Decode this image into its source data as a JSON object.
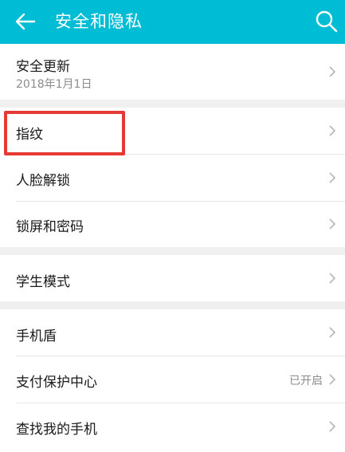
{
  "colors": {
    "accent": "#00bcd4",
    "highlight": "#e53935"
  },
  "header": {
    "back_icon": "arrow-left-icon",
    "title": "安全和隐私",
    "search_icon": "search-icon"
  },
  "groups": [
    {
      "items": [
        {
          "label": "安全更新",
          "sub": "2018年1月1日",
          "chevron_icon": "chevron-right-icon"
        }
      ]
    },
    {
      "items": [
        {
          "label": "指纹",
          "chevron_icon": "chevron-right-icon"
        },
        {
          "label": "人脸解锁",
          "chevron_icon": "chevron-right-icon"
        },
        {
          "label": "锁屏和密码",
          "chevron_icon": "chevron-right-icon"
        }
      ]
    },
    {
      "items": [
        {
          "label": "学生模式",
          "chevron_icon": "chevron-right-icon"
        }
      ]
    },
    {
      "items": [
        {
          "label": "手机盾",
          "chevron_icon": "chevron-right-icon"
        },
        {
          "label": "支付保护中心",
          "value": "已开启",
          "chevron_icon": "chevron-right-icon"
        },
        {
          "label": "查找我的手机",
          "chevron_icon": "chevron-right-icon"
        }
      ]
    }
  ]
}
